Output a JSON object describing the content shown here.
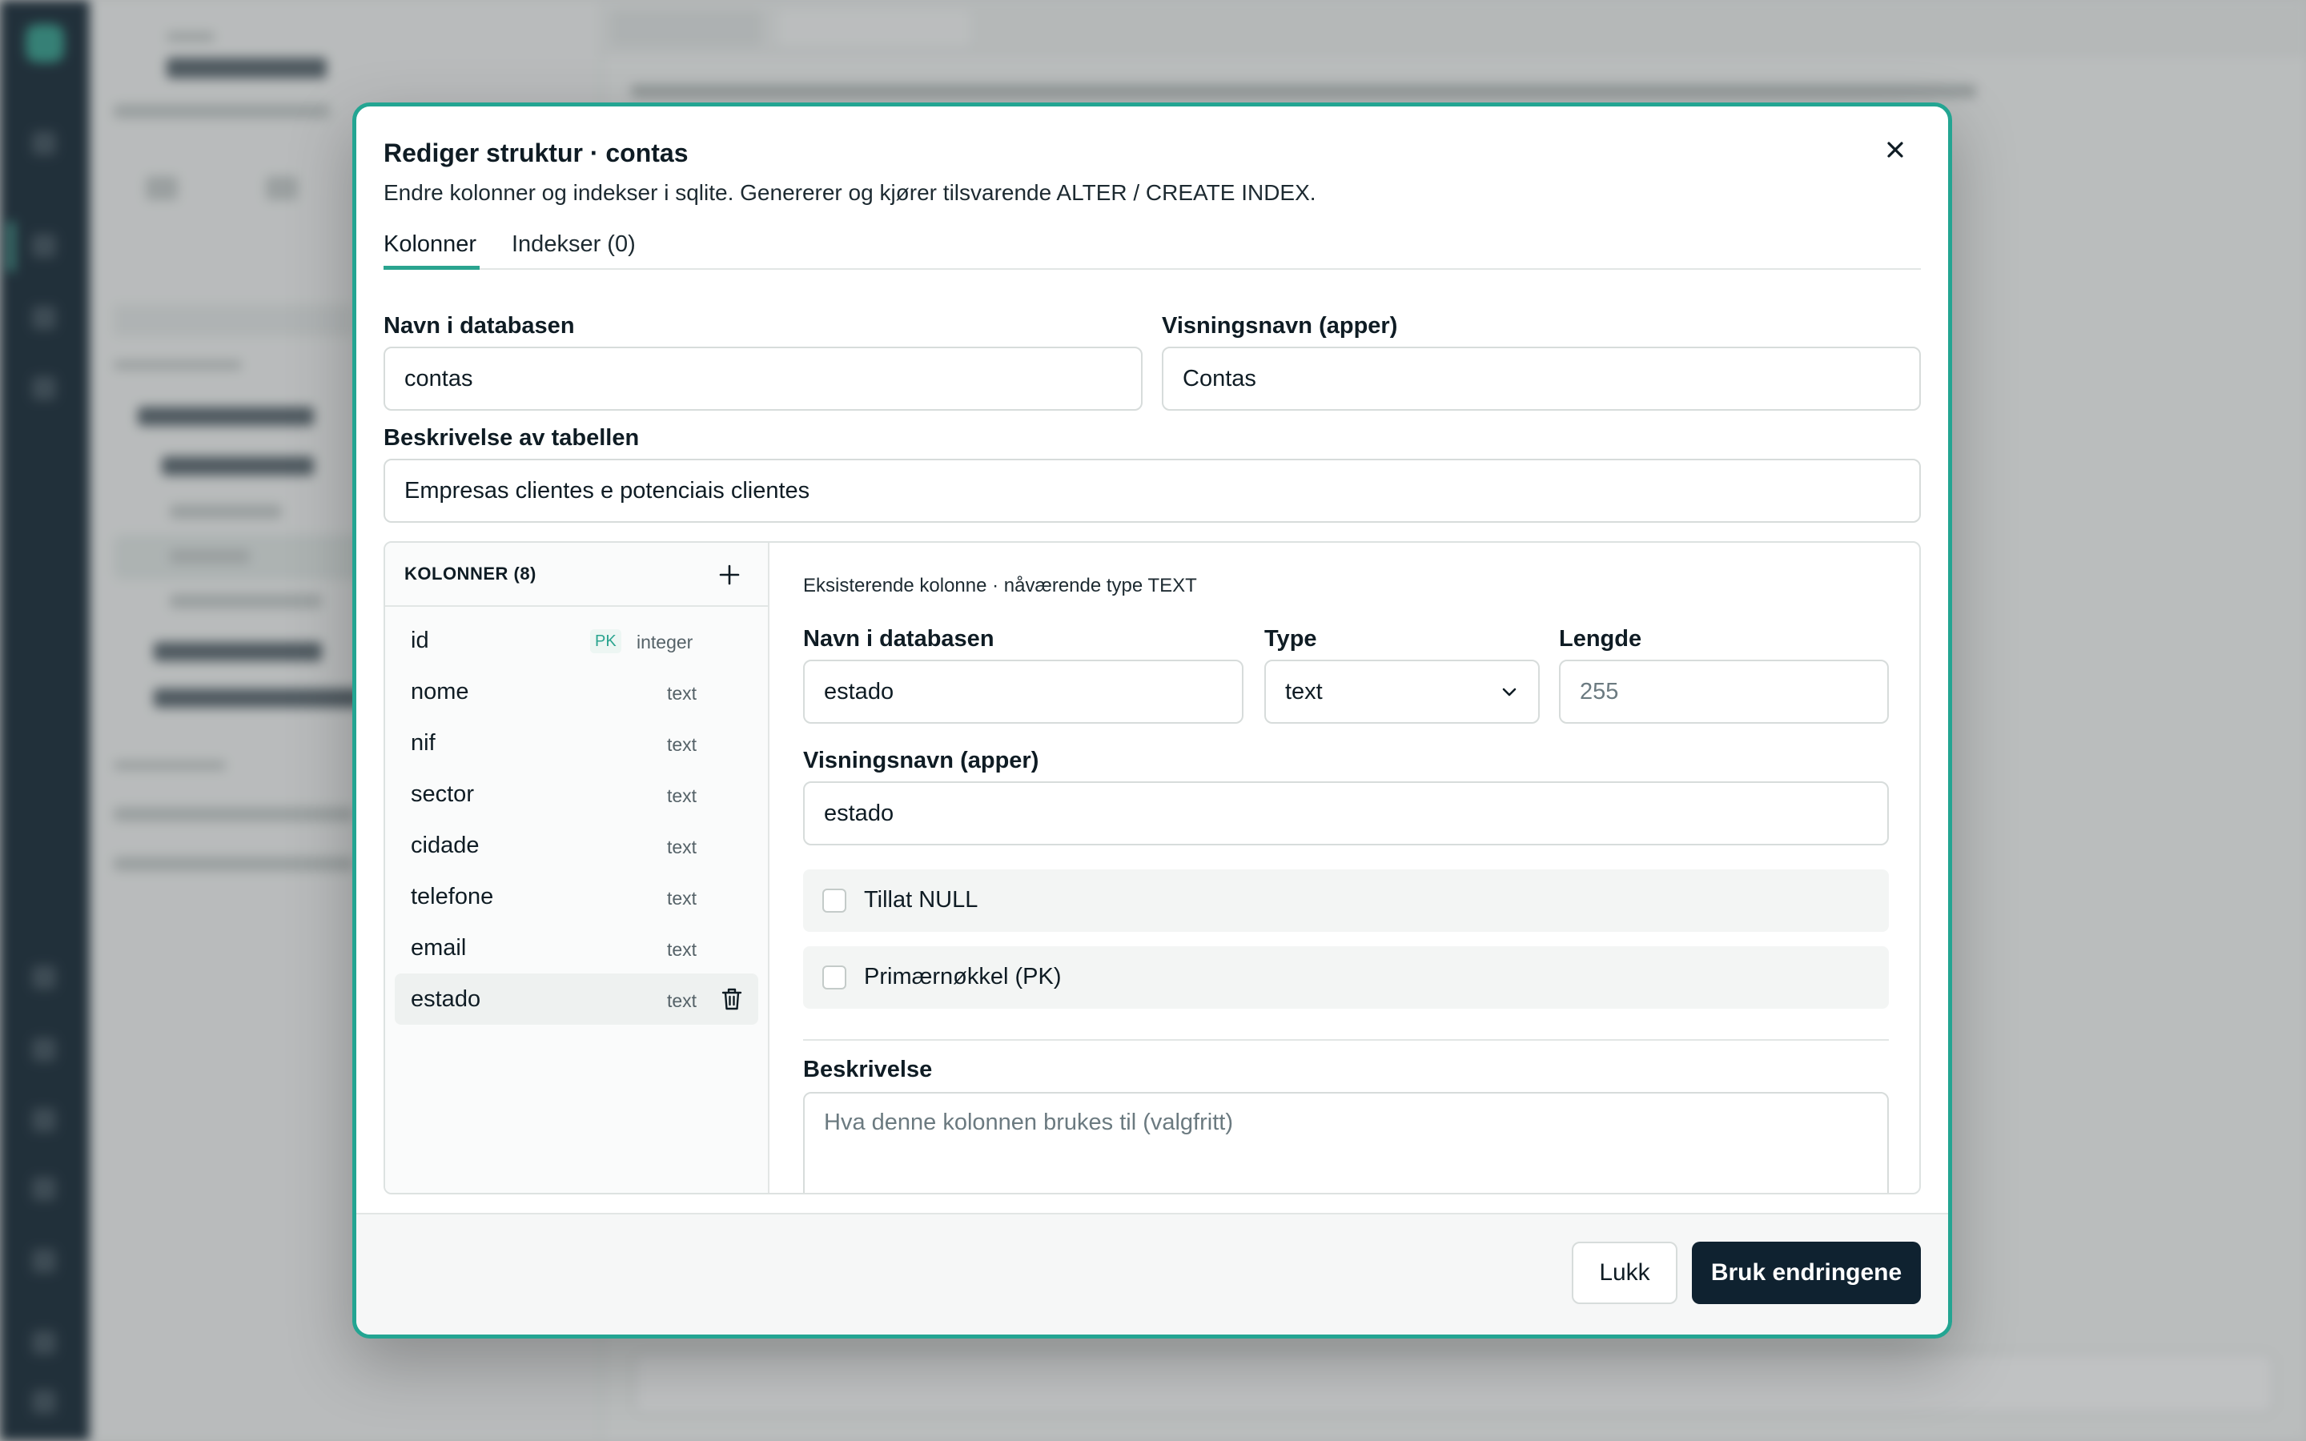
{
  "dialog": {
    "title": "Rediger struktur · contas",
    "subtitle": "Endre kolonner og indekser i sqlite. Genererer og kjører tilsvarende ALTER / CREATE INDEX.",
    "close_icon": "close-icon"
  },
  "tabs": [
    {
      "label": "Kolonner",
      "active": true
    },
    {
      "label": "Indekser (0)",
      "active": false
    }
  ],
  "table": {
    "db_name_label": "Navn i databasen",
    "db_name_value": "contas",
    "display_name_label": "Visningsnavn (apper)",
    "display_name_value": "Contas",
    "description_label": "Beskrivelse av tabellen",
    "description_value": "Empresas clientes e potenciais clientes"
  },
  "columns_panel": {
    "title": "KOLONNER (8)",
    "add_icon": "plus-icon",
    "pk_badge": "PK",
    "items": [
      {
        "name": "id",
        "type": "integer",
        "pk": true
      },
      {
        "name": "nome",
        "type": "text"
      },
      {
        "name": "nif",
        "type": "text"
      },
      {
        "name": "sector",
        "type": "text"
      },
      {
        "name": "cidade",
        "type": "text"
      },
      {
        "name": "telefone",
        "type": "text"
      },
      {
        "name": "email",
        "type": "text"
      },
      {
        "name": "estado",
        "type": "text",
        "selected": true
      }
    ]
  },
  "column_detail": {
    "note": "Eksisterende kolonne · nåværende type TEXT",
    "db_name_label": "Navn i databasen",
    "db_name_value": "estado",
    "type_label": "Type",
    "type_value": "text",
    "length_label": "Lengde",
    "length_placeholder": "255",
    "display_name_label": "Visningsnavn (apper)",
    "display_name_value": "estado",
    "allow_null_label": "Tillat NULL",
    "allow_null_checked": false,
    "pk_label": "Primærnøkkel (PK)",
    "pk_checked": false,
    "description_label": "Beskrivelse",
    "description_placeholder": "Hva denne kolonnen brukes til (valgfritt)"
  },
  "footer": {
    "close_label": "Lukk",
    "apply_label": "Bruk endringene"
  },
  "colors": {
    "accent": "#23a592",
    "primary_button": "#0f2230",
    "rail": "#0f2230"
  }
}
